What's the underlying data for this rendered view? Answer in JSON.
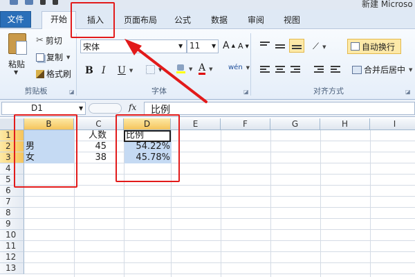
{
  "window": {
    "title": "新建 Microso"
  },
  "tabs": {
    "file": "文件",
    "home": "开始",
    "insert": "插入",
    "page_layout": "页面布局",
    "formulas": "公式",
    "data": "数据",
    "review": "审阅",
    "view": "视图"
  },
  "ribbon": {
    "clipboard": {
      "paste": "粘贴",
      "cut": "剪切",
      "copy": "复制",
      "format_painter": "格式刷",
      "group_label": "剪贴板"
    },
    "font": {
      "font_name": "宋体",
      "font_size": "11",
      "grow": "A",
      "shrink": "A",
      "bold": "B",
      "italic": "I",
      "underline": "U",
      "font_color": "A",
      "phonetic": "wén",
      "group_label": "字体"
    },
    "alignment": {
      "wrap_text": "自动换行",
      "merge_center": "合并后居中",
      "group_label": "对齐方式"
    }
  },
  "formula_bar": {
    "name_box": "D1",
    "fx": "fx",
    "content": "比例"
  },
  "sheet": {
    "columns": [
      "B",
      "C",
      "D",
      "E",
      "F",
      "G",
      "H",
      "I"
    ],
    "rows": [
      "1",
      "2",
      "3",
      "4",
      "5",
      "6",
      "7",
      "8",
      "9",
      "10",
      "11",
      "12",
      "13"
    ],
    "cells": {
      "C1": "人数",
      "D1": "比例",
      "B2": "男",
      "C2": "45",
      "D2": "54.22%",
      "B3": "女",
      "C3": "38",
      "D3": "45.78%"
    }
  },
  "colors": {
    "accent": "#2a6fb9",
    "annotation": "#e21a1a",
    "selection": "#c5daf3",
    "selected_header": "#f5c45c"
  },
  "icons": {
    "paste": "paste-icon",
    "cut": "scissors-icon",
    "copy": "copy-icon",
    "format_painter": "brush-icon",
    "borders": "border-icon",
    "fill": "fill-bucket-icon",
    "wrap": "wrap-text-icon",
    "merge": "merge-icon",
    "fx": "function-icon"
  }
}
